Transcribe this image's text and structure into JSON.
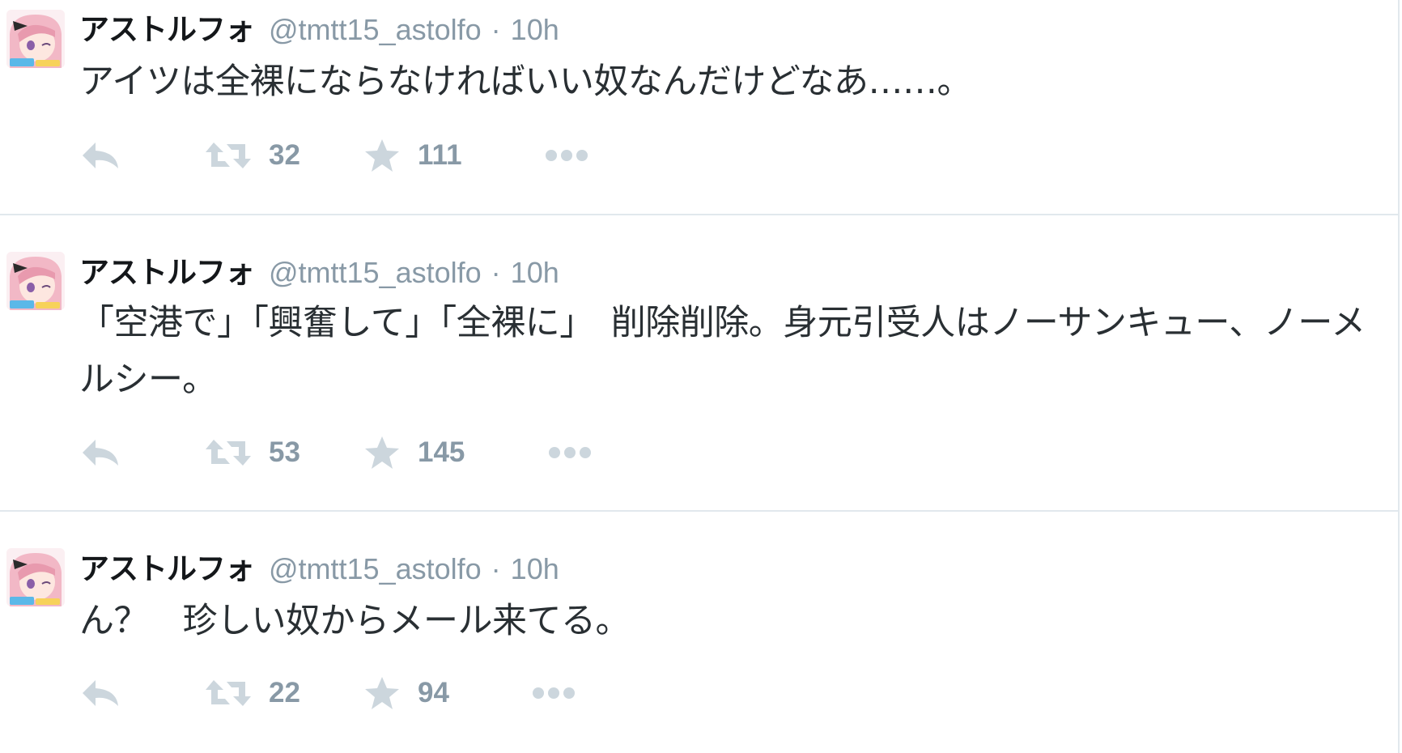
{
  "colors": {
    "divider": "#e1e8ed",
    "muted": "#8899a6",
    "text": "#292f33",
    "name": "#14171a",
    "action_icon": "#ccd6dd",
    "avatar_hair": "#f2b8c6",
    "avatar_skin": "#fde7e0"
  },
  "tweets": [
    {
      "name": "アストルフォ",
      "handle": "@tmtt15_astolfo",
      "separator": "·",
      "time": "10h",
      "text": "アイツは全裸にならなければいい奴なんだけどなあ……。",
      "retweets": "32",
      "favorites": "111",
      "icons": {
        "reply": "reply-icon",
        "retweet": "retweet-icon",
        "favorite": "star-icon",
        "more": "more-dots-icon"
      }
    },
    {
      "name": "アストルフォ",
      "handle": "@tmtt15_astolfo",
      "separator": "·",
      "time": "10h",
      "text": "「空港で」「興奮して」「全裸に」　削除削除。身元引受人はノーサンキュー、ノーメルシー。",
      "retweets": "53",
      "favorites": "145",
      "icons": {
        "reply": "reply-icon",
        "retweet": "retweet-icon",
        "favorite": "star-icon",
        "more": "more-dots-icon"
      }
    },
    {
      "name": "アストルフォ",
      "handle": "@tmtt15_astolfo",
      "separator": "·",
      "time": "10h",
      "text": "ん？　珍しい奴からメール来てる。",
      "retweets": "22",
      "favorites": "94",
      "icons": {
        "reply": "reply-icon",
        "retweet": "retweet-icon",
        "favorite": "star-icon",
        "more": "more-dots-icon"
      }
    }
  ]
}
